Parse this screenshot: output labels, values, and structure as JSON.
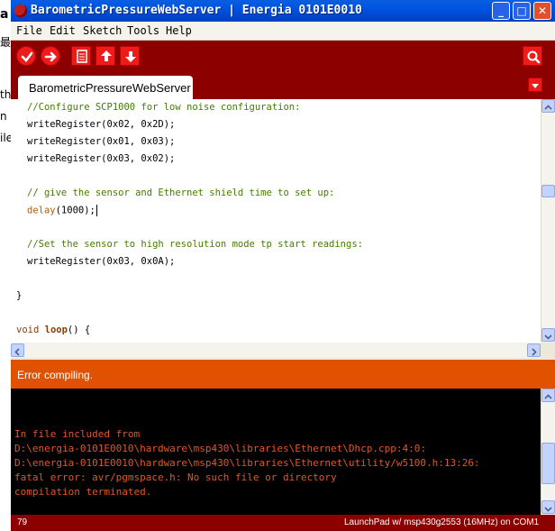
{
  "background": {
    "chars": [
      "a",
      "最",
      "th",
      "n",
      "ile"
    ]
  },
  "window": {
    "title": "BarometricPressureWebServer | Energia 0101E0010",
    "icon": "energia-app-icon",
    "controls": {
      "minimize": "_",
      "maximize": "□",
      "close": "✕"
    }
  },
  "menubar": {
    "items": [
      "File",
      "Edit",
      "Sketch",
      "Tools",
      "Help"
    ]
  },
  "toolbar": {
    "buttons": [
      "verify-icon",
      "upload-icon",
      "new-icon",
      "open-icon",
      "save-icon",
      "serial-monitor-icon"
    ]
  },
  "tabs": {
    "active": "BarometricPressureWebServer"
  },
  "editor": {
    "lines": {
      "l1": "//Configure SCP1000 for low noise configuration:",
      "l2": "writeRegister(0x02, 0x2D);",
      "l3": "writeRegister(0x01, 0x03);",
      "l4": "writeRegister(0x03, 0x02);",
      "l5": "// give the sensor and Ethernet shield time to set up:",
      "l6a": "delay",
      "l6b": "(1000);",
      "l7": "//Set the sensor to high resolution mode tp start readings:",
      "l8": "writeRegister(0x03, 0x0A);",
      "l9": "}",
      "l10a": "void",
      "l10b": "loop",
      "l10c": "() {"
    }
  },
  "status": {
    "message": "Error compiling."
  },
  "console": {
    "lines": [
      "In file included from",
      "D:\\energia-0101E0010\\hardware\\msp430\\libraries\\Ethernet\\Dhcp.cpp:4:0:",
      "D:\\energia-0101E0010\\hardware\\msp430\\libraries\\Ethernet\\utility/w5100.h:13:26:",
      "fatal error: avr/pgmspace.h: No such file or directory",
      "compilation terminated."
    ]
  },
  "footer": {
    "line_number": "79",
    "board": "LaunchPad w/ msp430g2553 (16MHz) on COM1"
  },
  "colors": {
    "toolbar": "#8c0000",
    "status_error": "#e15200",
    "console_text": "#e45626",
    "comment": "#437d00"
  }
}
